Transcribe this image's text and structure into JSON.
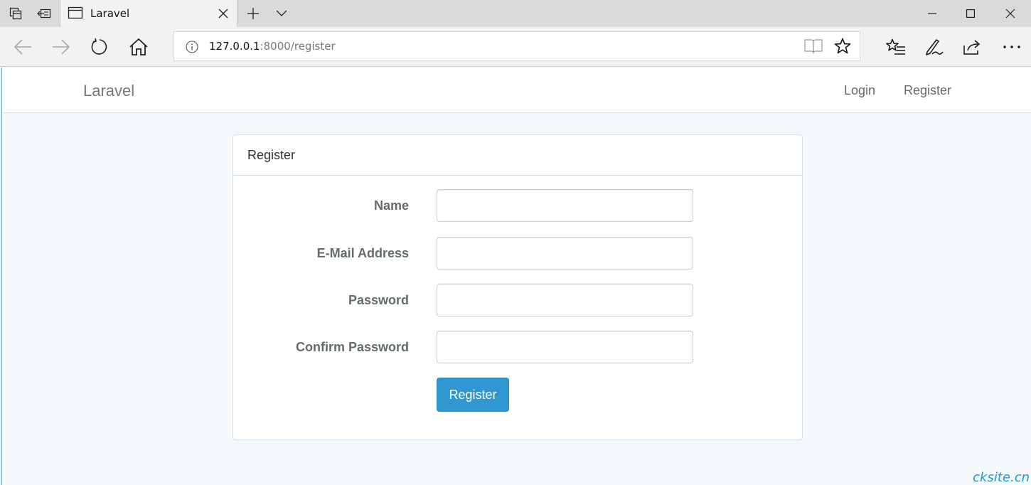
{
  "browser": {
    "tab_title": "Laravel",
    "url_host": "127.0.0.1",
    "url_rest": ":8000/register"
  },
  "app": {
    "brand": "Laravel",
    "nav": {
      "login": "Login",
      "register": "Register"
    }
  },
  "panel": {
    "heading": "Register",
    "fields": [
      {
        "label": "Name",
        "value": ""
      },
      {
        "label": "E-Mail Address",
        "value": ""
      },
      {
        "label": "Password",
        "value": ""
      },
      {
        "label": "Confirm Password",
        "value": ""
      }
    ],
    "submit_label": "Register"
  },
  "watermark": "cksite.cn",
  "colors": {
    "primary_button": "#3097d1",
    "page_background": "#f5f8fa",
    "label_text": "#636b6f"
  }
}
